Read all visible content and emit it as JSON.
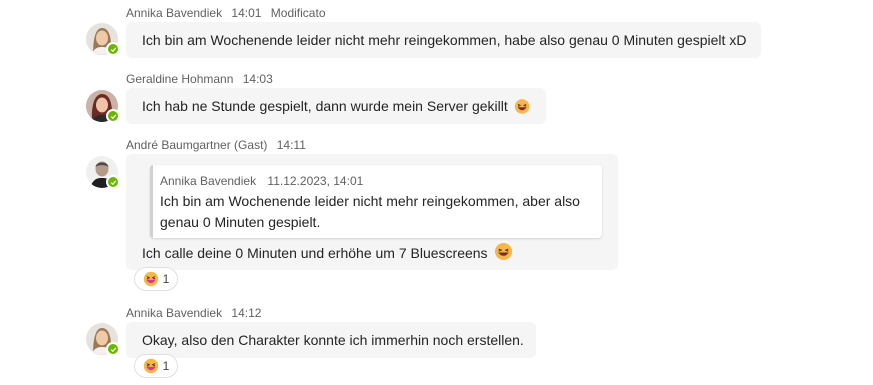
{
  "messages": [
    {
      "author": "Annika Bavendiek",
      "time": "14:01",
      "edited": "Modificato",
      "text": "Ich bin am Wochenende leider nicht mehr reingekommen, habe also genau 0 Minuten gespielt xD"
    },
    {
      "author": "Geraldine Hohmann",
      "time": "14:03",
      "text": "Ich hab ne Stunde gespielt, dann wurde mein Server gekillt",
      "emoji": "grinning-squinting-face"
    },
    {
      "author": "André Baumgartner (Gast)",
      "time": "14:11",
      "quote": {
        "author": "Annika Bavendiek",
        "datetime": "11.12.2023, 14:01",
        "text": "Ich bin am Wochenende leider nicht mehr reingekommen, aber also genau 0 Minuten gespielt."
      },
      "text": "Ich calle deine 0 Minuten und erhöhe um 7 Bluescreens",
      "emoji": "grinning-squinting-face",
      "reaction": {
        "emoji": "laughing-face",
        "count": "1"
      }
    },
    {
      "author": "Annika Bavendiek",
      "time": "14:12",
      "text": "Okay, also den Charakter konnte ich immerhin noch erstellen.",
      "reaction": {
        "emoji": "laughing-face",
        "count": "1"
      }
    }
  ],
  "colors": {
    "bubble": "#f5f5f5",
    "presence": "#6bb700",
    "meta_text": "#616161"
  }
}
